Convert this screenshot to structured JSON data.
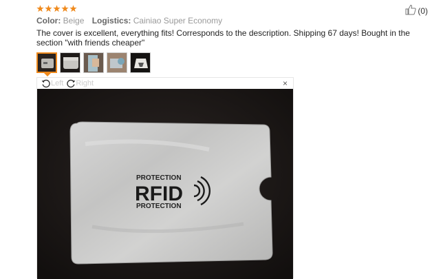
{
  "rating": {
    "stars": 5
  },
  "helpful": {
    "icon": "thumbs-up-icon",
    "count": "(0)"
  },
  "meta": {
    "color_key": "Color:",
    "color_value": "Beige",
    "logistics_key": "Logistics:",
    "logistics_value": "Cainiao Super Economy"
  },
  "review": {
    "text": "The cover is excellent, everything fits! Corresponds to the description. Shipping 67 days! Bought in the section \"with friends cheaper\""
  },
  "thumbnails": {
    "count": 5,
    "selected_index": 0
  },
  "viewer": {
    "rotate_left_label": "Left",
    "rotate_right_label": "Right",
    "close_label": "×",
    "photo": {
      "line1": "PROTECTION",
      "brand": "RFID",
      "line2": "PROTECTION"
    }
  },
  "colors": {
    "star": "#f08a1c",
    "accent": "#f08a1c"
  }
}
